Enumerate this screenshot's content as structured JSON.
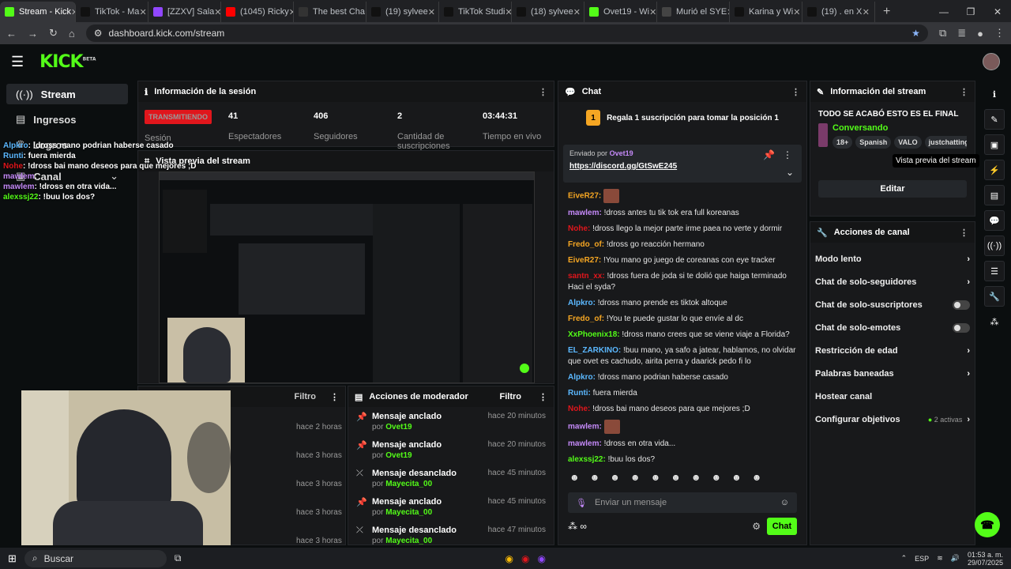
{
  "browser": {
    "tabs": [
      {
        "title": "Stream - Kick",
        "color": "#53fc18",
        "active": true
      },
      {
        "title": "TikTok - Ma",
        "color": "#111111"
      },
      {
        "title": "[ZZXV] Sala",
        "color": "#9147ff"
      },
      {
        "title": "(1045) Ricky",
        "color": "#ff0000"
      },
      {
        "title": "The best Cha",
        "color": "#333333"
      },
      {
        "title": "(19) sylvee",
        "color": "#111111"
      },
      {
        "title": "TikTok Studi",
        "color": "#111111"
      },
      {
        "title": "(18) sylvee",
        "color": "#111111"
      },
      {
        "title": "Ovet19 - Wi",
        "color": "#53fc18"
      },
      {
        "title": "Murió el SYE",
        "color": "#444444"
      },
      {
        "title": "Karina y Wi",
        "color": "#111111"
      },
      {
        "title": "(19) . en X",
        "color": "#111111"
      }
    ],
    "url": "dashboard.kick.com/stream"
  },
  "brand": {
    "logo": "KICK",
    "beta": "BETA"
  },
  "sidebar": {
    "items": [
      {
        "label": "Stream",
        "icon": "broadcast-icon"
      },
      {
        "label": "Ingresos",
        "icon": "money-icon"
      },
      {
        "label": "Logros",
        "icon": "trophy-icon"
      },
      {
        "label": "Canal",
        "icon": "channel-icon"
      }
    ]
  },
  "session": {
    "title": "Información de la sesión",
    "status": "TRANSMITIENDO",
    "status_sub": "Sesión",
    "stats": [
      {
        "value": "41",
        "label": "Espectadores"
      },
      {
        "value": "406",
        "label": "Seguidores"
      },
      {
        "value": "2",
        "label": "Cantidad de suscripciones"
      },
      {
        "value": "03:44:31",
        "label": "Tiempo en vivo"
      }
    ]
  },
  "preview": {
    "title": "Vista previa del stream"
  },
  "chat": {
    "title": "Chat",
    "gift_text": "Regala 1 suscripción para tomar la posición 1",
    "gift_num": "1",
    "pinned_by_label": "Enviado por",
    "pinned_by": "Ovet19",
    "pinned_link": "https://discord.gg/GtSwE245",
    "messages": [
      {
        "user": "EiveR27:",
        "color": "#f5a623",
        "text": "[emote]"
      },
      {
        "user": "mawlem:",
        "color": "#c58af9",
        "text": "!dross antes tu tik tok era full koreanas"
      },
      {
        "user": "Nohe:",
        "color": "#e0161c",
        "text": "!dross llego la mejor parte irme paea no verte y dormir"
      },
      {
        "user": "Fredo_of:",
        "color": "#f5a623",
        "text": "!dross go reacción hermano"
      },
      {
        "user": "EiveR27:",
        "color": "#f5a623",
        "text": "!You mano go juego de coreanas con eye tracker"
      },
      {
        "user": "santn_xx:",
        "color": "#e0161c",
        "text": "!dross fuera de joda si te dolió que haiga terminado Haci el syda?"
      },
      {
        "user": "Alpkro:",
        "color": "#5bb8ff",
        "text": "!dross mano prende es tiktok altoque"
      },
      {
        "user": "Fredo_of:",
        "color": "#f5a623",
        "text": "!You te puede gustar lo que envíe al dc"
      },
      {
        "user": "XxPhoenix18:",
        "color": "#53fc18",
        "text": "!dross mano crees que se viene viaje a Florida?"
      },
      {
        "user": "EL_ZARKINO:",
        "color": "#5bb8ff",
        "text": "!buu mano, ya safo a jatear, hablamos, no olvidar que ovet es cachudo, airita perra y daarick pedo fi lo"
      },
      {
        "user": "Alpkro:",
        "color": "#5bb8ff",
        "text": "!dross mano podrian haberse casado"
      },
      {
        "user": "Runti:",
        "color": "#5bb8ff",
        "text": "fuera mierda"
      },
      {
        "user": "Nohe:",
        "color": "#e0161c",
        "text": "!dross bai mano deseos para que mejores ;D"
      },
      {
        "user": "mawlem:",
        "color": "#c58af9",
        "text": "[emote]"
      },
      {
        "user": "mawlem:",
        "color": "#c58af9",
        "text": "!dross en otra vida..."
      },
      {
        "user": "alexssj22:",
        "color": "#53fc18",
        "text": "!buu los dos?"
      }
    ],
    "input_placeholder": "Enviar un mensaje",
    "send_label": "Chat"
  },
  "stream_info": {
    "title": "Información del stream",
    "stream_title": "TODO SE ACABÓ ESTO ES EL FINAL",
    "category": "Conversando",
    "tags": [
      "18+",
      "Spanish",
      "VALO",
      "justchatting"
    ],
    "edit_label": "Editar"
  },
  "channel_actions": {
    "title": "Acciones de canal",
    "items": [
      {
        "label": "Modo lento",
        "kind": "chevron"
      },
      {
        "label": "Chat de solo-seguidores",
        "kind": "chevron"
      },
      {
        "label": "Chat de solo-suscriptores",
        "kind": "toggle"
      },
      {
        "label": "Chat de solo-emotes",
        "kind": "toggle"
      },
      {
        "label": "Restricción de edad",
        "kind": "chevron"
      },
      {
        "label": "Palabras baneadas",
        "kind": "chevron"
      },
      {
        "label": "Hostear canal",
        "kind": "none"
      },
      {
        "label": "Configurar objetivos",
        "kind": "chevron",
        "badge": "2 activas"
      }
    ]
  },
  "tooltip": "Vista previa del stream",
  "left_panel": {
    "filter_label": "Filtro",
    "times": [
      "hace 2 horas",
      "hace 3 horas",
      "hace 3 horas",
      "hace 3 horas",
      "hace 3 horas"
    ]
  },
  "mod_actions": {
    "title": "Acciones de moderador",
    "filter_label": "Filtro",
    "rows": [
      {
        "action": "Mensaje anclado",
        "by_label": "por",
        "by": "Ovet19",
        "time": "hace 20 minutos",
        "icon": "pin-icon"
      },
      {
        "action": "Mensaje anclado",
        "by_label": "por",
        "by": "Ovet19",
        "time": "hace 20 minutos",
        "icon": "pin-icon"
      },
      {
        "action": "Mensaje desanclado",
        "by_label": "por",
        "by": "Mayecita_00",
        "time": "hace 45 minutos",
        "icon": "unpin-icon"
      },
      {
        "action": "Mensaje anclado",
        "by_label": "por",
        "by": "Mayecita_00",
        "time": "hace 45 minutos",
        "icon": "pin-icon"
      },
      {
        "action": "Mensaje desanclado",
        "by_label": "por",
        "by": "Mayecita_00",
        "time": "hace 47 minutos",
        "icon": "unpin-icon"
      }
    ]
  },
  "overlay_chat": [
    {
      "user": "Alpkro",
      "text": ": !dross mano podrian haberse casado",
      "color": "#5bb8ff"
    },
    {
      "user": "Runti",
      "text": ": fuera mierda",
      "color": "#5bb8ff"
    },
    {
      "user": "Nohe",
      "text": ": !dross bai mano deseos para que mejores ;D",
      "color": "#e0161c"
    },
    {
      "user": "mawlem",
      "text": ":",
      "color": "#c58af9"
    },
    {
      "user": "mawlem",
      "text": ": !dross en otra vida...",
      "color": "#c58af9"
    },
    {
      "user": "alexssj22",
      "text": ": !buu los dos?",
      "color": "#53fc18"
    }
  ],
  "taskbar": {
    "search": "Buscar",
    "lang": "ESP",
    "time": "01:53 a. m.",
    "date": "29/07/2025"
  },
  "colors": {
    "accent": "#53fc18",
    "live": "#e0161c",
    "panel": "#18191b"
  }
}
